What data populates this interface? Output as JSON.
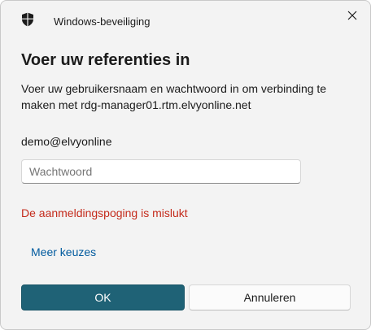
{
  "window": {
    "title": "Windows-beveiliging",
    "close_icon": "close-icon",
    "app_icon": "shield-icon"
  },
  "dialog": {
    "heading": "Voer uw referenties in",
    "description": "Voer uw gebruikersnaam en wachtwoord in om verbinding te maken met rdg-manager01.rtm.elvyonline.net",
    "username": "demo@elvyonline",
    "password": {
      "placeholder": "Wachtwoord",
      "value": ""
    },
    "error": "De aanmeldingspoging is mislukt",
    "more_choices": "Meer keuzes"
  },
  "buttons": {
    "ok": "OK",
    "cancel": "Annuleren"
  },
  "colors": {
    "primary": "#1f6276",
    "error": "#c42b1c",
    "link": "#005a9e",
    "background": "#f3f3f3"
  }
}
